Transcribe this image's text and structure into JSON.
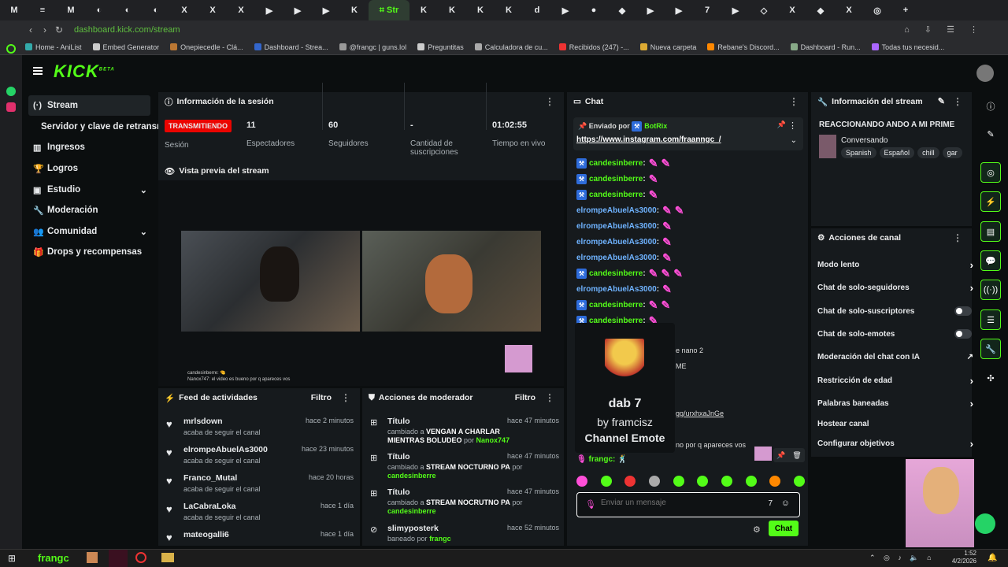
{
  "browser": {
    "tabs": [
      "M",
      "≡",
      "M",
      "◐",
      "◐",
      "◐",
      "X",
      "X",
      "X",
      "▶",
      "▶",
      "▶",
      "K",
      "⌗ Str",
      "K",
      "K",
      "K",
      "K",
      "d",
      "▶",
      "●",
      "◆",
      "▶",
      "▶",
      "7",
      "▶",
      "◇",
      "X",
      "◆",
      "X",
      "◎",
      "+"
    ],
    "url": "dashboard.kick.com/stream",
    "bookmarks": [
      "Home - AniList",
      "Embed Generator",
      "Onepiecedle - Clá...",
      "Dashboard - Strea...",
      "@frangc | guns.lol",
      "Preguntitas",
      "Calculadora de cu...",
      "Recibidos (247) -...",
      "Nueva carpeta",
      "Rebane's Discord...",
      "Dashboard - Run...",
      "Todas tus necesid..."
    ]
  },
  "brand": {
    "logo": "KICK",
    "beta": "BETA",
    "accent": "#53fc18"
  },
  "sidebar": {
    "items": [
      {
        "label": "Stream",
        "icon": "broadcast-icon"
      },
      {
        "label": "Servidor y clave de retransm",
        "icon": ""
      },
      {
        "label": "Ingresos",
        "icon": "chart-icon"
      },
      {
        "label": "Logros",
        "icon": "trophy-icon"
      },
      {
        "label": "Estudio",
        "icon": "studio-icon"
      },
      {
        "label": "Moderación",
        "icon": "wrench-icon"
      },
      {
        "label": "Comunidad",
        "icon": "people-icon"
      },
      {
        "label": "Drops y recompensas",
        "icon": "gift-icon"
      }
    ]
  },
  "session": {
    "title": "Información de la sesión",
    "live_badge": "TRANSMITIENDO",
    "live_sub": "Sesión",
    "stats": [
      {
        "value": "11",
        "label": "Espectadores"
      },
      {
        "value": "60",
        "label": "Seguidores"
      },
      {
        "value": "-",
        "label": "Cantidad de suscripciones"
      },
      {
        "value": "01:02:55",
        "label": "Tiempo en vivo"
      }
    ]
  },
  "preview": {
    "title": "Vista previa del stream",
    "overlay_line1": "candesinberre: 🤏",
    "overlay_line2": "Nanox747: el video es bueno por q apareces vos"
  },
  "feed": {
    "title": "Feed de actividades",
    "filter": "Filtro",
    "items": [
      {
        "name": "mrlsdown",
        "sub": "acaba de seguir el canal",
        "time": "hace 2 minutos"
      },
      {
        "name": "elrompeAbuelAs3000",
        "sub": "acaba de seguir el canal",
        "time": "hace 23 minutos"
      },
      {
        "name": "Franco_Mutal",
        "sub": "acaba de seguir el canal",
        "time": "hace 20 horas"
      },
      {
        "name": "LaCabraLoka",
        "sub": "acaba de seguir el canal",
        "time": "hace 1 día"
      },
      {
        "name": "mateogalli6",
        "sub": "",
        "time": "hace 1 día"
      }
    ]
  },
  "modactions": {
    "title": "Acciones de moderador",
    "filter": "Filtro",
    "items": [
      {
        "name": "Título",
        "pre": "cambiado a",
        "val": "VENGAN A CHARLAR MIENTRAS BOLUDEO",
        "by": "por",
        "user": "Nanox747",
        "time": "hace 47 minutos"
      },
      {
        "name": "Título",
        "pre": "cambiado a",
        "val": "STREAM NOCTURNO PA",
        "by": "por",
        "user": "candesinberre",
        "time": "hace 47 minutos"
      },
      {
        "name": "Título",
        "pre": "cambiado a",
        "val": "STREAM NOCRUTNO PA",
        "by": "por",
        "user": "candesinberre",
        "time": "hace 47 minutos"
      },
      {
        "name": "slimyposterk",
        "pre": "baneado por",
        "val": "",
        "by": "",
        "user": "frangc",
        "time": "hace 52 minutos"
      }
    ]
  },
  "chat": {
    "title": "Chat",
    "pinned_label": "Enviado por",
    "pinned_user": "BotRix",
    "pinned_link": "https://www.instagram.com/fraanngc_/",
    "lines": [
      {
        "user": "candesinberre",
        "emotes": 2,
        "color": "#53fc18",
        "badge": true
      },
      {
        "user": "candesinberre",
        "emotes": 1,
        "color": "#53fc18",
        "badge": true
      },
      {
        "user": "candesinberre",
        "emotes": 1,
        "color": "#53fc18",
        "badge": true
      },
      {
        "user": "elrompeAbuelAs3000",
        "emotes": 2,
        "color": "#6fb3ff",
        "badge": false
      },
      {
        "user": "elrompeAbuelAs3000",
        "emotes": 1,
        "color": "#6fb3ff",
        "badge": false
      },
      {
        "user": "elrompeAbuelAs3000",
        "emotes": 1,
        "color": "#6fb3ff",
        "badge": false
      },
      {
        "user": "elrompeAbuelAs3000",
        "emotes": 1,
        "color": "#6fb3ff",
        "badge": false
      },
      {
        "user": "candesinberre",
        "emotes": 3,
        "color": "#53fc18",
        "badge": true
      },
      {
        "user": "elrompeAbuelAs3000",
        "emotes": 1,
        "color": "#6fb3ff",
        "badge": false
      },
      {
        "user": "candesinberre",
        "emotes": 2,
        "color": "#53fc18",
        "badge": true
      },
      {
        "user": "candesinberre",
        "emotes": 1,
        "color": "#53fc18",
        "badge": true
      }
    ],
    "partial_lines": [
      "e nano 2",
      "ME",
      "gg/urxhxaJnGe",
      "no por q apareces vos"
    ],
    "last_user": "frangc",
    "emote_card": {
      "name": "dab",
      "by": "by framcisz",
      "type": "Channel Emote"
    },
    "input_placeholder": "Enviar un mensaje",
    "send": "Chat"
  },
  "stream_info": {
    "title": "Información del stream",
    "stream_title": "REACCIONANDO ANDO A MI PRIME",
    "category": "Conversando",
    "tags": [
      "Spanish",
      "Español",
      "chill",
      "gar"
    ]
  },
  "channel_actions": {
    "title": "Acciones de canal",
    "items": [
      {
        "label": "Modo lento",
        "type": "arrow"
      },
      {
        "label": "Chat de solo-seguidores",
        "type": "arrow"
      },
      {
        "label": "Chat de solo-suscriptores",
        "type": "toggle"
      },
      {
        "label": "Chat de solo-emotes",
        "type": "toggle"
      },
      {
        "label": "Moderación del chat con IA",
        "type": "ext"
      },
      {
        "label": "Restricción de edad",
        "type": "arrow"
      },
      {
        "label": "Palabras baneadas",
        "type": "arrow"
      },
      {
        "label": "Hostear canal",
        "type": "none"
      },
      {
        "label": "Configurar objetivos",
        "type": "arrow"
      }
    ]
  },
  "taskbar": {
    "app": "frangc",
    "time": "1:52",
    "date": "4/2/2026"
  }
}
